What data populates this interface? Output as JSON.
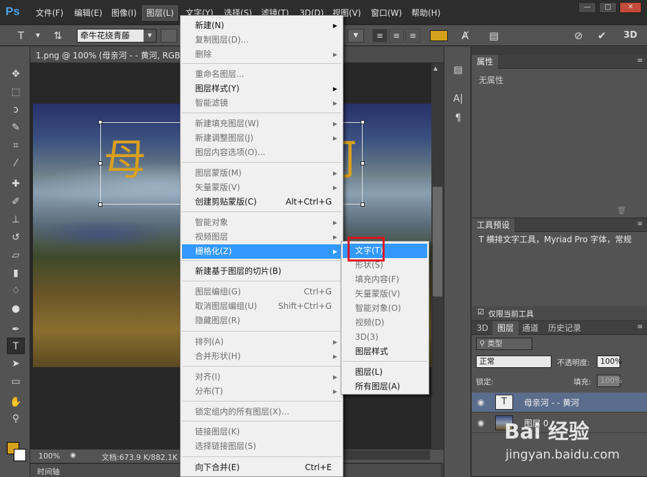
{
  "app": {
    "logo": "Ps"
  },
  "menubar": {
    "items": [
      "文件(F)",
      "编辑(E)",
      "图像(I)",
      "图层(L)",
      "文字(Y)",
      "选择(S)",
      "滤镜(T)",
      "3D(D)",
      "视图(V)",
      "窗口(W)",
      "帮助(H)"
    ],
    "active_index": 3
  },
  "window_controls": [
    "—",
    "□",
    "✕"
  ],
  "options_bar": {
    "font_family": "牵牛花绕青藤",
    "text_color": "#d4a11c",
    "label_3d": "3D"
  },
  "document": {
    "tab_title": "1.png @ 100% (母亲河 - - 黄河, RGB/",
    "canvas_text_left": "母",
    "canvas_text_right": "河",
    "zoom": "100%",
    "doc_info": "文档:673.9 K/882.1K"
  },
  "timeline": {
    "label": "时间轴"
  },
  "layer_menu": {
    "items": [
      {
        "label": "新建(N)",
        "disabled": false,
        "submenu": true
      },
      {
        "label": "复制图层(D)...",
        "disabled": true
      },
      {
        "label": "删除",
        "disabled": true,
        "submenu": true
      },
      {
        "label": "重命名图层...",
        "disabled": true
      },
      {
        "label": "图层样式(Y)",
        "disabled": false,
        "submenu": true
      },
      {
        "label": "智能滤镜",
        "disabled": true,
        "submenu": true
      },
      {
        "label": "新建填充图层(W)",
        "disabled": true,
        "submenu": true
      },
      {
        "label": "新建调整图层(J)",
        "disabled": true,
        "submenu": true
      },
      {
        "label": "图层内容选项(O)...",
        "disabled": true
      },
      {
        "label": "图层蒙版(M)",
        "disabled": true,
        "submenu": true
      },
      {
        "label": "矢量蒙版(V)",
        "disabled": true,
        "submenu": true
      },
      {
        "label": "创建剪贴蒙版(C)",
        "disabled": false,
        "shortcut": "Alt+Ctrl+G"
      },
      {
        "label": "智能对象",
        "disabled": true,
        "submenu": true
      },
      {
        "label": "视频图层",
        "disabled": true,
        "submenu": true
      },
      {
        "label": "栅格化(Z)",
        "disabled": false,
        "submenu": true,
        "highlighted": true
      },
      {
        "label": "新建基于图层的切片(B)",
        "disabled": false
      },
      {
        "label": "图层编组(G)",
        "disabled": true,
        "shortcut": "Ctrl+G"
      },
      {
        "label": "取消图层编组(U)",
        "disabled": true,
        "shortcut": "Shift+Ctrl+G"
      },
      {
        "label": "隐藏图层(R)",
        "disabled": true
      },
      {
        "label": "排列(A)",
        "disabled": true,
        "submenu": true
      },
      {
        "label": "合并形状(H)",
        "disabled": true,
        "submenu": true
      },
      {
        "label": "对齐(I)",
        "disabled": true,
        "submenu": true
      },
      {
        "label": "分布(T)",
        "disabled": true,
        "submenu": true
      },
      {
        "label": "锁定组内的所有图层(X)...",
        "disabled": true
      },
      {
        "label": "链接图层(K)",
        "disabled": true
      },
      {
        "label": "选择链接图层(S)",
        "disabled": true
      },
      {
        "label": "向下合并(E)",
        "disabled": false,
        "shortcut": "Ctrl+E"
      }
    ]
  },
  "rasterize_menu": {
    "items": [
      {
        "label": "文字(T)",
        "disabled": false,
        "highlighted": true
      },
      {
        "label": "形状(S)",
        "disabled": true
      },
      {
        "label": "填充内容(F)",
        "disabled": true
      },
      {
        "label": "矢量蒙版(V)",
        "disabled": true
      },
      {
        "label": "智能对象(O)",
        "disabled": true
      },
      {
        "label": "视频(D)",
        "disabled": true
      },
      {
        "label": "3D(3)",
        "disabled": true
      },
      {
        "label": "图层样式",
        "disabled": false
      },
      {
        "label": "图层(L)",
        "disabled": false
      },
      {
        "label": "所有图层(A)",
        "disabled": false
      }
    ]
  },
  "properties_panel": {
    "title": "属性",
    "empty_text": "无属性"
  },
  "tool_presets_panel": {
    "title": "工具预设",
    "preset_text": "横排文字工具，Myriad Pro 字体，常规",
    "current_tool_only": "仅限当前工具"
  },
  "layers_panel": {
    "tabs": [
      "3D",
      "图层",
      "通道",
      "历史记录"
    ],
    "active_tab": 1,
    "filter_label": "类型",
    "blend_mode": "正常",
    "opacity_label": "不透明度:",
    "opacity_value": "100%",
    "lock_label": "锁定:",
    "fill_label": "填充:",
    "fill_value": "100%",
    "layers": [
      {
        "name": "母亲河 - - 黄河",
        "type": "text",
        "selected": true
      },
      {
        "name": "图层 0",
        "type": "image",
        "selected": false
      }
    ]
  },
  "watermark": {
    "logo_text": "Bai 经验",
    "url": "jingyan.baidu.com"
  }
}
